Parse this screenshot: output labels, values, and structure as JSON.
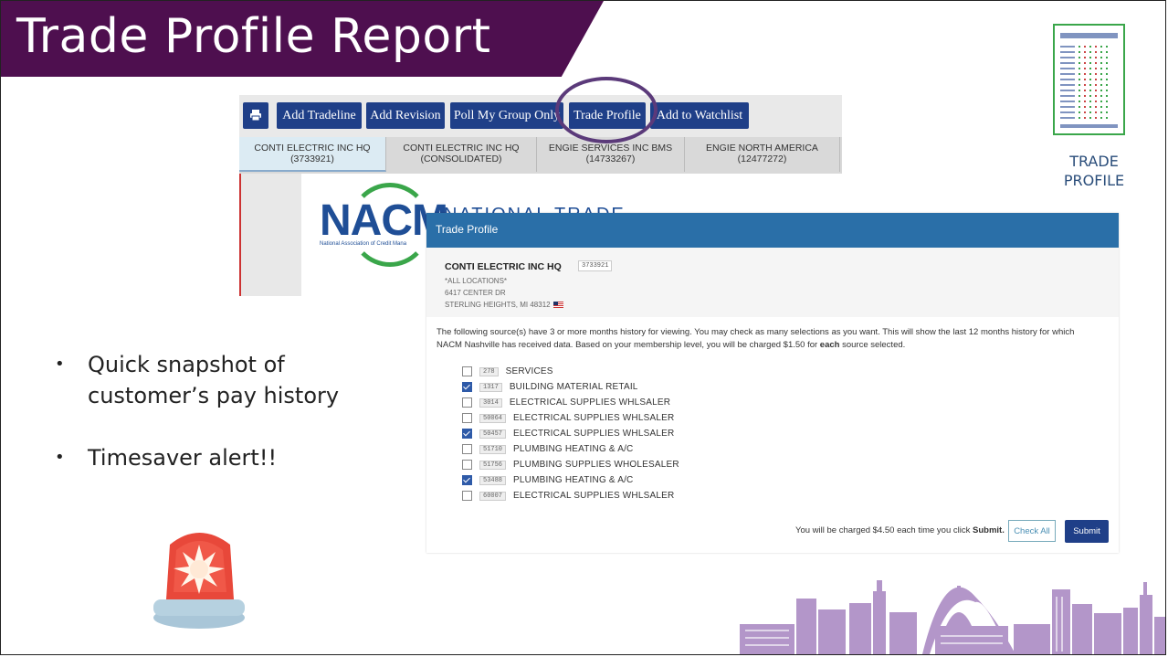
{
  "slide": {
    "title": "Trade Profile Report",
    "bullets": [
      "Quick snapshot of customer’s pay history",
      "Timesaver alert!!"
    ],
    "bullet_lines": [
      [
        "Quick snapshot of",
        "customer’s pay history"
      ],
      [
        "Timesaver alert!!"
      ]
    ],
    "icon_label_lines": [
      "TRADE",
      "PROFILE"
    ]
  },
  "toolbar": {
    "print_icon": "printer-icon",
    "buttons": [
      "Add Tradeline",
      "Add Revision",
      "Poll My Group Only",
      "Trade Profile",
      "Add to Watchlist"
    ]
  },
  "tabs": [
    {
      "name": "CONTI ELECTRIC INC HQ",
      "sub": "(3733921)",
      "active": true
    },
    {
      "name": "CONTI ELECTRIC INC HQ",
      "sub": "(CONSOLIDATED)",
      "active": false
    },
    {
      "name": "ENGIE SERVICES INC BMS",
      "sub": "(14733267)",
      "active": false
    },
    {
      "name": "ENGIE NORTH AMERICA",
      "sub": "(12477272)",
      "active": false
    }
  ],
  "background_logo": {
    "brand": "NACM",
    "text": "NATIONAL TRADE",
    "sub": "National Association of Credit Mana"
  },
  "modal": {
    "title": "Trade Profile",
    "customer": {
      "name": "CONTI ELECTRIC INC HQ",
      "id": "3733921",
      "lines": [
        "*ALL LOCATIONS*",
        "6417 CENTER DR",
        "STERLING HEIGHTS, MI 48312"
      ]
    },
    "description_lines": [
      "The following source(s) have 3 or more months history for viewing. You may check as many selections as you want. This will show the last 12 months history for which",
      "NACM Nashville has received data. Based on your membership level, you will be charged $1.50 for each source selected."
    ],
    "sources": [
      {
        "code": "278",
        "name": "SERVICES",
        "checked": false
      },
      {
        "code": "1317",
        "name": "BUILDING MATERIAL RETAIL",
        "checked": true
      },
      {
        "code": "3014",
        "name": "ELECTRICAL SUPPLIES WHLSALER",
        "checked": false
      },
      {
        "code": "50064",
        "name": "ELECTRICAL SUPPLIES WHLSALER",
        "checked": false
      },
      {
        "code": "50457",
        "name": "ELECTRICAL SUPPLIES WHLSALER",
        "checked": true
      },
      {
        "code": "51710",
        "name": "PLUMBING HEATING & A/C",
        "checked": false
      },
      {
        "code": "51756",
        "name": "PLUMBING SUPPLIES WHOLESALER",
        "checked": false
      },
      {
        "code": "53488",
        "name": "PLUMBING HEATING & A/C",
        "checked": true
      },
      {
        "code": "60007",
        "name": "ELECTRICAL SUPPLIES WHLSALER",
        "checked": false
      }
    ],
    "charge_text": "You will be charged $4.50 each time you click",
    "charge_bold": "Submit.",
    "check_all_label": "Check All",
    "submit_label": "Submit"
  },
  "colors": {
    "title_band": "#4e0f4f",
    "modal_header": "#2a6fa8",
    "button": "#1f3f88",
    "highlight_oval": "#5b3a7a"
  },
  "decor_icons": [
    "trade-profile-document-icon",
    "emergency-siren-icon",
    "city-skyline-graphic"
  ]
}
